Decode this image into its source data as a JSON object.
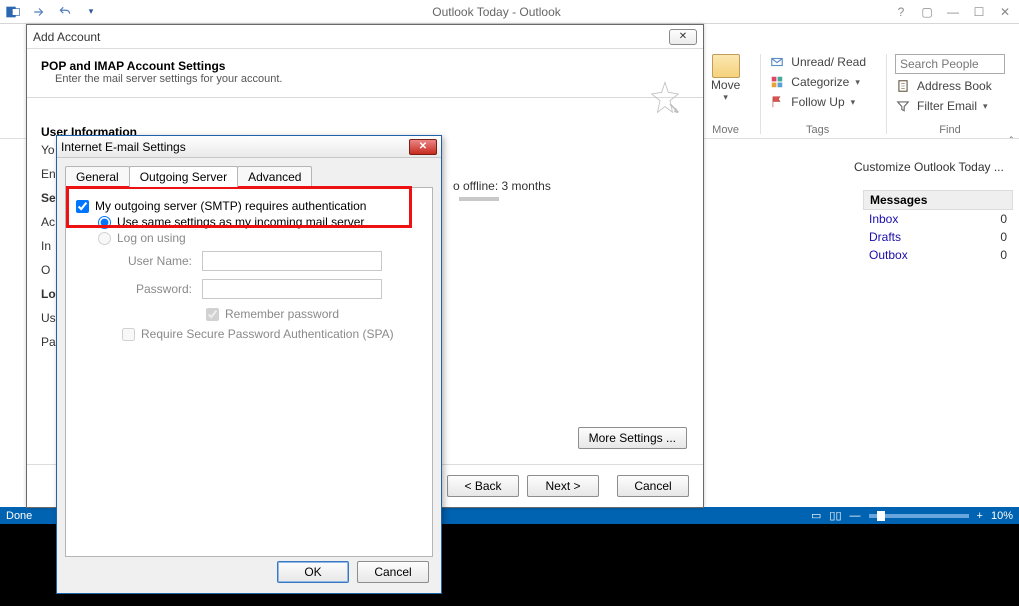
{
  "window": {
    "title": "Outlook Today - Outlook",
    "help": "?"
  },
  "ribbon": {
    "move_label": "Move",
    "move_drop": "▾",
    "group_move": "Move",
    "unread": "Unread/ Read",
    "categorize": "Categorize",
    "followup": "Follow Up",
    "group_tags": "Tags",
    "search_placeholder": "Search People",
    "addressbook": "Address Book",
    "filteremail": "Filter Email",
    "group_find": "Find"
  },
  "today": {
    "customize": "Customize Outlook Today ...",
    "header": "Messages",
    "rows": [
      {
        "label": "Inbox",
        "count": "0"
      },
      {
        "label": "Drafts",
        "count": "0"
      },
      {
        "label": "Outbox",
        "count": "0"
      }
    ]
  },
  "status": {
    "left": "Done",
    "zoom": "10%",
    "plus": "+"
  },
  "addaccount": {
    "title": "Add Account",
    "heading": "POP and IMAP Account Settings",
    "sub": "Enter the mail server settings for your account.",
    "userinfo": "User Information",
    "short_labels": [
      "Yo",
      "En",
      "Se",
      "Ac",
      "In",
      "O",
      "Lo",
      "Us",
      "Pa"
    ],
    "offline": "o offline:   3 months",
    "more": "More Settings ...",
    "back": "< Back",
    "next": "Next >",
    "cancel": "Cancel"
  },
  "emaildlg": {
    "title": "Internet E-mail Settings",
    "tabs": {
      "general": "General",
      "outgoing": "Outgoing Server",
      "advanced": "Advanced"
    },
    "smtp_auth": "My outgoing server (SMTP) requires authentication",
    "same_settings": "Use same settings as my incoming mail server",
    "logon_using": "Log on using",
    "username": "User Name:",
    "password": "Password:",
    "remember": "Remember password",
    "spa": "Require Secure Password Authentication (SPA)",
    "ok": "OK",
    "cancel": "Cancel"
  }
}
